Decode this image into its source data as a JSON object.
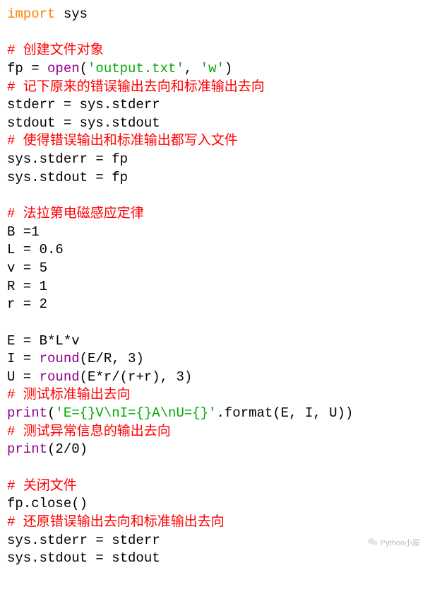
{
  "code": {
    "l1_import": "import",
    "l1_sys": " sys",
    "l3_comment": "# 创建文件对象",
    "l4_a": "fp = ",
    "l4_open": "open",
    "l4_p1": "(",
    "l4_s1": "'output.txt'",
    "l4_c": ", ",
    "l4_s2": "'w'",
    "l4_p2": ")",
    "l5_comment": "# 记下原来的错误输出去向和标准输出去向",
    "l6": "stderr = sys.stderr",
    "l7": "stdout = sys.stdout",
    "l8_comment": "# 使得错误输出和标准输出都写入文件",
    "l9": "sys.stderr = fp",
    "l10": "sys.stdout = fp",
    "l12_comment": "# 法拉第电磁感应定律",
    "l13": "B =1",
    "l14": "L = 0.6",
    "l15": "v = 5",
    "l16": "R = 1",
    "l17": "r = 2",
    "l19": "E = B*L*v",
    "l20_a": "I = ",
    "l20_round": "round",
    "l20_b": "(E/R, 3)",
    "l21_a": "U = ",
    "l21_round": "round",
    "l21_b": "(E*r/(r+r), 3)",
    "l22_comment": "# 测试标准输出去向",
    "l23_print": "print",
    "l23_p1": "(",
    "l23_s": "'E={}V\\nI={}A\\nU={}'",
    "l23_b": ".format(E, I, U))",
    "l24_comment": "# 测试异常信息的输出去向",
    "l25_print": "print",
    "l25_b": "(2/0)",
    "l27_comment": "# 关闭文件",
    "l28": "fp.close()",
    "l29_comment": "# 还原错误输出去向和标准输出去向",
    "l30": "sys.stderr = stderr",
    "l31": "sys.stdout = stdout"
  },
  "watermark": "Python小屋"
}
